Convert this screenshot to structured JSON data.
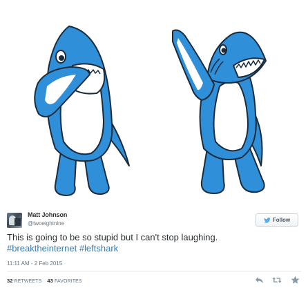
{
  "tweet": {
    "author_name": "Matt Johnson",
    "author_handle": "@twoeightnine",
    "follow_label": "Follow",
    "text": "This is going to be so stupid but I can't stop laughing.",
    "hashtags": [
      "#breaktheinternet",
      "#leftshark"
    ],
    "timestamp": "11:11 AM - 2 Feb 2015",
    "retweets_count": "32",
    "retweets_label": "RETWEETS",
    "favorites_count": "43",
    "favorites_label": "FAVORITES"
  },
  "icons": {
    "follow": "twitter-bird-icon",
    "reply": "reply-icon",
    "retweet": "retweet-icon",
    "favorite": "star-icon"
  },
  "colors": {
    "shark_blue": "#2f8fd8",
    "shark_outline": "#1a2b3c",
    "hashtag": "#2b7bb9",
    "muted_text": "#66757f",
    "action_icon": "#8899a6"
  }
}
